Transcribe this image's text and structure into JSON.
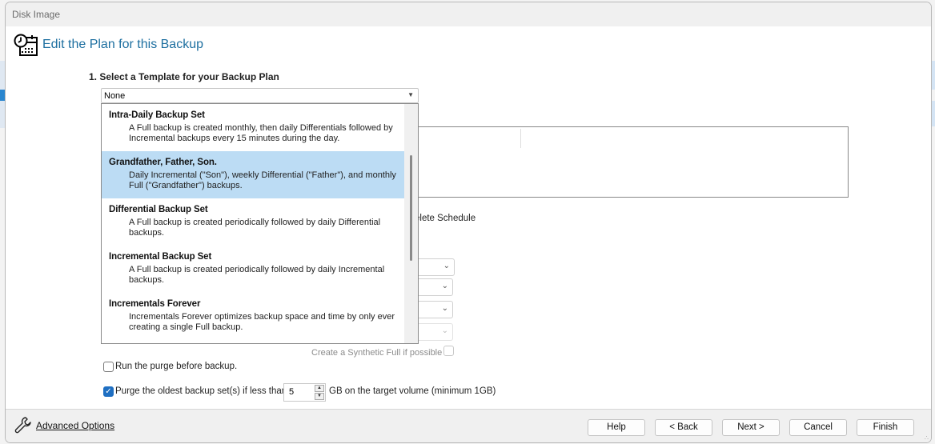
{
  "window": {
    "title": "Disk Image",
    "header_title": "Edit the Plan for this Backup"
  },
  "template_section": {
    "label": "1. Select a Template for your Backup Plan",
    "selected_value": "None",
    "options": [
      {
        "title": "Intra-Daily Backup Set",
        "description": "A Full backup is created monthly, then daily Differentials followed by Incremental backups every 15 minutes during the day.",
        "selected": false
      },
      {
        "title": "Grandfather, Father, Son.",
        "description": "Daily Incremental (\"Son\"), weekly Differential (\"Father\"), and monthly Full (\"Grandfather\") backups.",
        "selected": true
      },
      {
        "title": "Differential Backup Set",
        "description": "A Full backup is created periodically followed by daily Differential backups.",
        "selected": false
      },
      {
        "title": "Incremental Backup Set",
        "description": "A Full backup is created periodically followed by daily Incremental backups.",
        "selected": false
      },
      {
        "title": "Incrementals Forever",
        "description": "Incrementals Forever optimizes backup space and time by only ever creating a single Full backup.",
        "selected": false
      }
    ]
  },
  "background": {
    "delete_schedule_fragment": "elete Schedule"
  },
  "options": {
    "synthetic_full_label": "Create a Synthetic Full if possible",
    "synthetic_full_checked": false,
    "run_purge_label": "Run the purge before backup.",
    "run_purge_checked": false,
    "purge_oldest_label": "Purge the oldest backup set(s) if less than",
    "purge_oldest_checked": true,
    "purge_gb_value": "5",
    "purge_suffix": "GB on the target volume (minimum 1GB)"
  },
  "footer": {
    "advanced_options": "Advanced Options",
    "buttons": {
      "help": "Help",
      "back": "< Back",
      "next": "Next >",
      "cancel": "Cancel",
      "finish": "Finish"
    }
  },
  "colors": {
    "header_title": "#1d6fa0",
    "selection": "#bcdcf4",
    "checkbox_checked": "#1f6fc2"
  }
}
